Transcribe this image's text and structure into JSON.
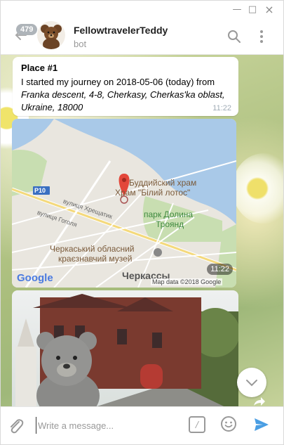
{
  "window": {
    "minimize": "—",
    "maximize": "□",
    "close": "×"
  },
  "header": {
    "unread_count": "479",
    "title": "FellowtravelerTeddy",
    "subtitle": "bot"
  },
  "message": {
    "title": "Place #1",
    "text_prefix": "I started my journey on 2018-05-06 (today) from ",
    "address": "Franka descent, 4-8, Cherkasy, Cherkas'ka oblast, Ukraine, 18000",
    "time": "11:22"
  },
  "map": {
    "labels": {
      "temple_line1": "Буддийский храм",
      "temple_line2": "Храм \"Білий лотос\"",
      "road_p10": "P10",
      "street1": "вулиця Хрещатик",
      "street2": "вулиця Гоголя",
      "park_line1": "парк Долина",
      "park_line2": "Троянд",
      "museum_line1": "Черкаський обласний",
      "museum_line2": "краєзнавчий музей",
      "city": "Черкассы",
      "google": "Google",
      "attribution": "Map data ©2018 Google"
    },
    "time": "11:22"
  },
  "composer": {
    "placeholder": "Write a message...",
    "commands_label": "/"
  }
}
